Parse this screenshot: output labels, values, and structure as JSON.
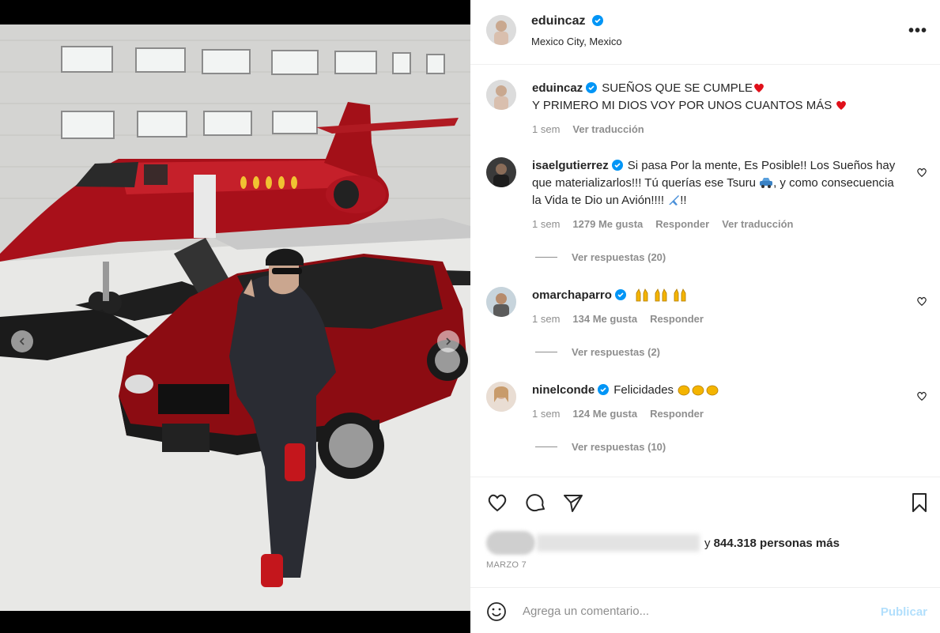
{
  "post": {
    "author": "eduincaz",
    "location": "Mexico City, Mexico",
    "more_label": "•••"
  },
  "caption": {
    "username": "eduincaz",
    "line1": "SUEÑOS QUE SE CUMPLE",
    "line2": "Y PRIMERO MI DIOS VOY POR UNOS CUANTOS MÁS",
    "time": "1 sem",
    "translate": "Ver traducción"
  },
  "comments": [
    {
      "username": "isaelgutierrez",
      "text_a": "Si pasa Por la mente, Es Posible!! Los Sueños hay que materializarlos!!! Tú querías ese Tsuru",
      "text_b": ", y como consecuencia la Vida te Dio un Avión!!!!",
      "text_c": "!!",
      "time": "1 sem",
      "likes": "1279 Me gusta",
      "reply": "Responder",
      "translate": "Ver traducción",
      "replies": "Ver respuestas (20)"
    },
    {
      "username": "omarchaparro",
      "time": "1 sem",
      "likes": "134 Me gusta",
      "reply": "Responder",
      "replies": "Ver respuestas (2)"
    },
    {
      "username": "ninelconde",
      "text": "Felicidades",
      "time": "1 sem",
      "likes": "124 Me gusta",
      "reply": "Responder",
      "replies": "Ver respuestas (10)"
    }
  ],
  "likes": {
    "prefix": "y",
    "count_text": "844.318 personas más"
  },
  "date": "MARZO 7",
  "composer": {
    "placeholder": "Agrega un comentario...",
    "publish": "Publicar"
  },
  "carousel": {
    "total": 9,
    "active": 6
  },
  "icons": [
    "chevron-left-icon",
    "chevron-right-icon",
    "more-icon",
    "verified-icon",
    "heart-icon",
    "comment-icon",
    "share-icon",
    "bookmark-icon",
    "emoji-icon",
    "red-heart-icon",
    "car-icon",
    "airplane-icon",
    "raised-hands-icon",
    "clapping-hands-icon"
  ],
  "colors": {
    "verified": "#0095f6",
    "publish": "#b2dffc",
    "muted": "#8e8e8e",
    "text": "#262626"
  }
}
